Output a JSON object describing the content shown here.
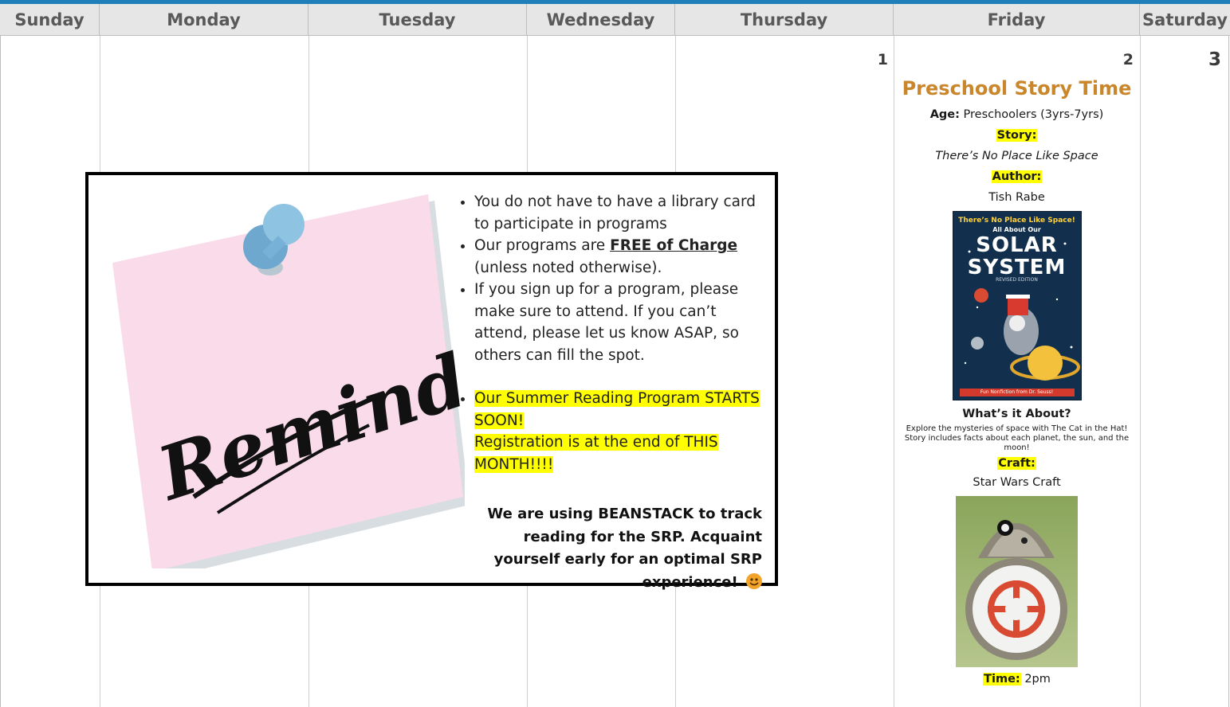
{
  "calendar": {
    "days": [
      "Sunday",
      "Monday",
      "Tuesday",
      "Wednesday",
      "Thursday",
      "Friday",
      "Saturday"
    ],
    "dates": {
      "thursday": "1",
      "friday": "2",
      "saturday": "3"
    }
  },
  "event": {
    "title": "Preschool Story Time",
    "age_label": "Age:",
    "age_value": "Preschoolers (3yrs-7yrs)",
    "story_label": "Story:",
    "story_value": "There’s No Place Like Space",
    "author_label": "Author:",
    "author_value": "Tish Rabe",
    "book_cover": {
      "line1": "There’s No Place Like Space!",
      "line2": "All About Our",
      "line3": "SOLAR",
      "line4": "SYSTEM",
      "line5": "REVISED EDITION",
      "line6": "Fun Nonfiction from Dr. Seuss!"
    },
    "about_label": "What’s it About?",
    "about_text": "Explore the mysteries of space with The Cat in the Hat! Story includes facts about each planet, the sun, and the moon!",
    "craft_label": "Craft:",
    "craft_value": "Star Wars Craft",
    "time_label": "Time:",
    "time_value": "2pm"
  },
  "reminder": {
    "note_word": "Reminder!",
    "bullet1": "You do not have to have a library card to participate in programs",
    "bullet2_pre": "Our programs are ",
    "bullet2_bold": "FREE of Charge",
    "bullet2_post": " (unless noted otherwise).",
    "bullet3": "If you sign up for a program, please make sure to attend. If you can’t attend, please let us know ASAP, so others can fill the spot.",
    "bullet4_line1": "Our Summer Reading Program STARTS SOON!",
    "bullet4_line2": "Registration is at the end of THIS MONTH!!!!",
    "footer": "We are using BEANSTACK to track reading for the SRP. Acquaint yourself early for an optimal SRP experience!"
  },
  "colors": {
    "accent_bar": "#1f7fb8",
    "event_title": "#c9862b",
    "highlight": "#ffff00",
    "note_pink": "#fadbe9"
  }
}
